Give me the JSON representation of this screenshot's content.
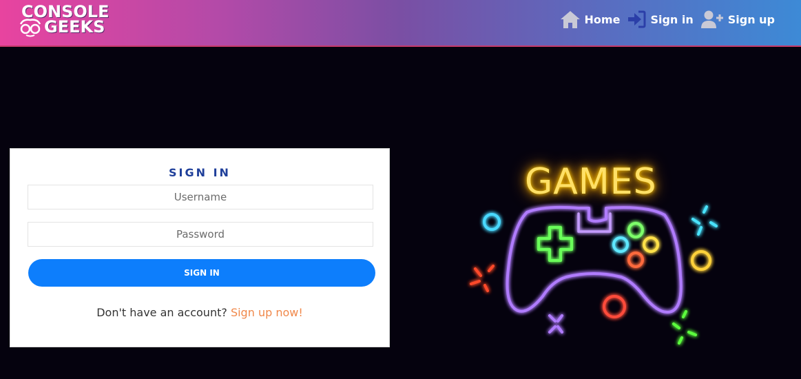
{
  "brand": {
    "line1": "CONSOLE",
    "line2": "GEEKS"
  },
  "nav": {
    "home": "Home",
    "signin": "Sign in",
    "signup": "Sign up"
  },
  "form": {
    "title": "SIGN IN",
    "username_placeholder": "Username",
    "password_placeholder": "Password",
    "submit_label": "SIGN IN",
    "footer_text": "Don't have an account?",
    "footer_link": "Sign up now!"
  },
  "hero": {
    "sign_text": "GAMES"
  },
  "colors": {
    "nav_start": "#e8449f",
    "nav_end": "#3d8ad6",
    "button": "#0d7efc",
    "title": "#1f3f9a",
    "link": "#f0884a",
    "background": "#05020e"
  }
}
